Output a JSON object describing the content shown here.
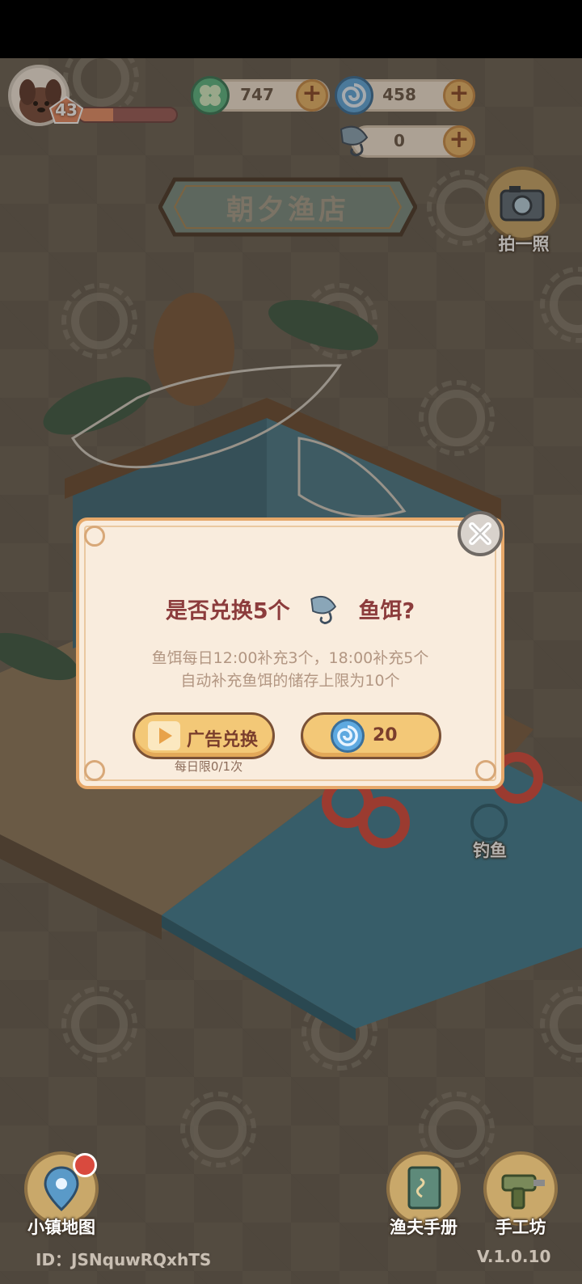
{
  "player": {
    "level": "43",
    "xp_progress": 0.35
  },
  "currencies": {
    "clover": "747",
    "shell": "458",
    "bait": "0"
  },
  "shop": {
    "title": "朝夕渔店"
  },
  "side_buttons": {
    "photo": "拍一照",
    "fishing": "钓鱼",
    "town_map": "小镇地图",
    "handbook": "渔夫手册",
    "workshop": "手工坊"
  },
  "dialog": {
    "title_prefix": "是否兑换5个",
    "title_suffix": "鱼饵?",
    "desc_line1": "鱼饵每日12:00补充3个，18:00补充5个",
    "desc_line2": "自动补充鱼饵的储存上限为10个",
    "ad_button": "广告兑换",
    "ad_limit": "每日限0/1次",
    "cost_button": "20"
  },
  "footer": {
    "user_id": "ID：JSNquwRQxhTS",
    "version": "V.1.0.10"
  },
  "colors": {
    "dialog_bg": "#f9ecdd",
    "dialog_border": "#e7a869",
    "title_text": "#8c3c3c",
    "button_fill": "#f3c877",
    "water": "#3f7f96"
  }
}
